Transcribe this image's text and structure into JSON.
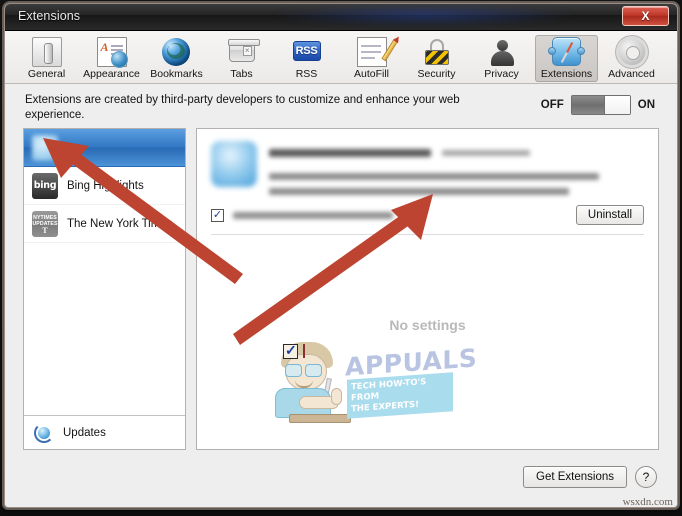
{
  "window": {
    "title": "Extensions",
    "close_label": "X"
  },
  "toolbar": {
    "items": [
      {
        "label": "General",
        "icon": "general-icon",
        "selected": false
      },
      {
        "label": "Appearance",
        "icon": "appearance-icon",
        "selected": false
      },
      {
        "label": "Bookmarks",
        "icon": "bookmarks-icon",
        "selected": false
      },
      {
        "label": "Tabs",
        "icon": "tabs-icon",
        "selected": false
      },
      {
        "label": "RSS",
        "icon": "rss-icon",
        "selected": false
      },
      {
        "label": "AutoFill",
        "icon": "autofill-icon",
        "selected": false
      },
      {
        "label": "Security",
        "icon": "security-icon",
        "selected": false
      },
      {
        "label": "Privacy",
        "icon": "privacy-icon",
        "selected": false
      },
      {
        "label": "Extensions",
        "icon": "extensions-icon",
        "selected": true
      },
      {
        "label": "Advanced",
        "icon": "advanced-icon",
        "selected": false
      }
    ],
    "rss_badge": "RSS",
    "appearance_glyph": "A"
  },
  "description": {
    "text": "Extensions are created by third-party developers to customize and enhance your web experience.",
    "toggle_off_label": "OFF",
    "toggle_on_label": "ON",
    "toggle_state": "ON"
  },
  "sidebar": {
    "items": [
      {
        "name": "",
        "icon": "blurred-extension-icon",
        "selected": true,
        "blurred": true
      },
      {
        "name": "Bing Highlights",
        "icon": "bing-icon",
        "selected": false,
        "blurred": false
      },
      {
        "name": "The New York Times",
        "icon": "nytimes-updates-icon",
        "selected": false,
        "blurred": false
      }
    ],
    "bing_logo_text": "bing",
    "nyt_logo_line1": "NYTIMES",
    "nyt_logo_line2": "UPDATES",
    "nyt_logo_glyph": "T",
    "updates_label": "Updates"
  },
  "detail": {
    "checkbox_checked": true,
    "checkbox_glyph": "✓",
    "uninstall_label": "Uninstall",
    "no_settings_label": "No settings"
  },
  "watermark": {
    "brand": "APPUALS",
    "tagline_line1": "TECH HOW-TO'S FROM",
    "tagline_line2": "THE EXPERTS!",
    "site": "wsxdn.com"
  },
  "footer": {
    "get_extensions_label": "Get Extensions",
    "help_label": "?"
  },
  "colors": {
    "accent_blue": "#3278c4",
    "arrow_red": "#bc4430",
    "close_red": "#c0392b",
    "watermark_blue": "#b9c4e2",
    "tagline_bg": "#a9dced"
  }
}
